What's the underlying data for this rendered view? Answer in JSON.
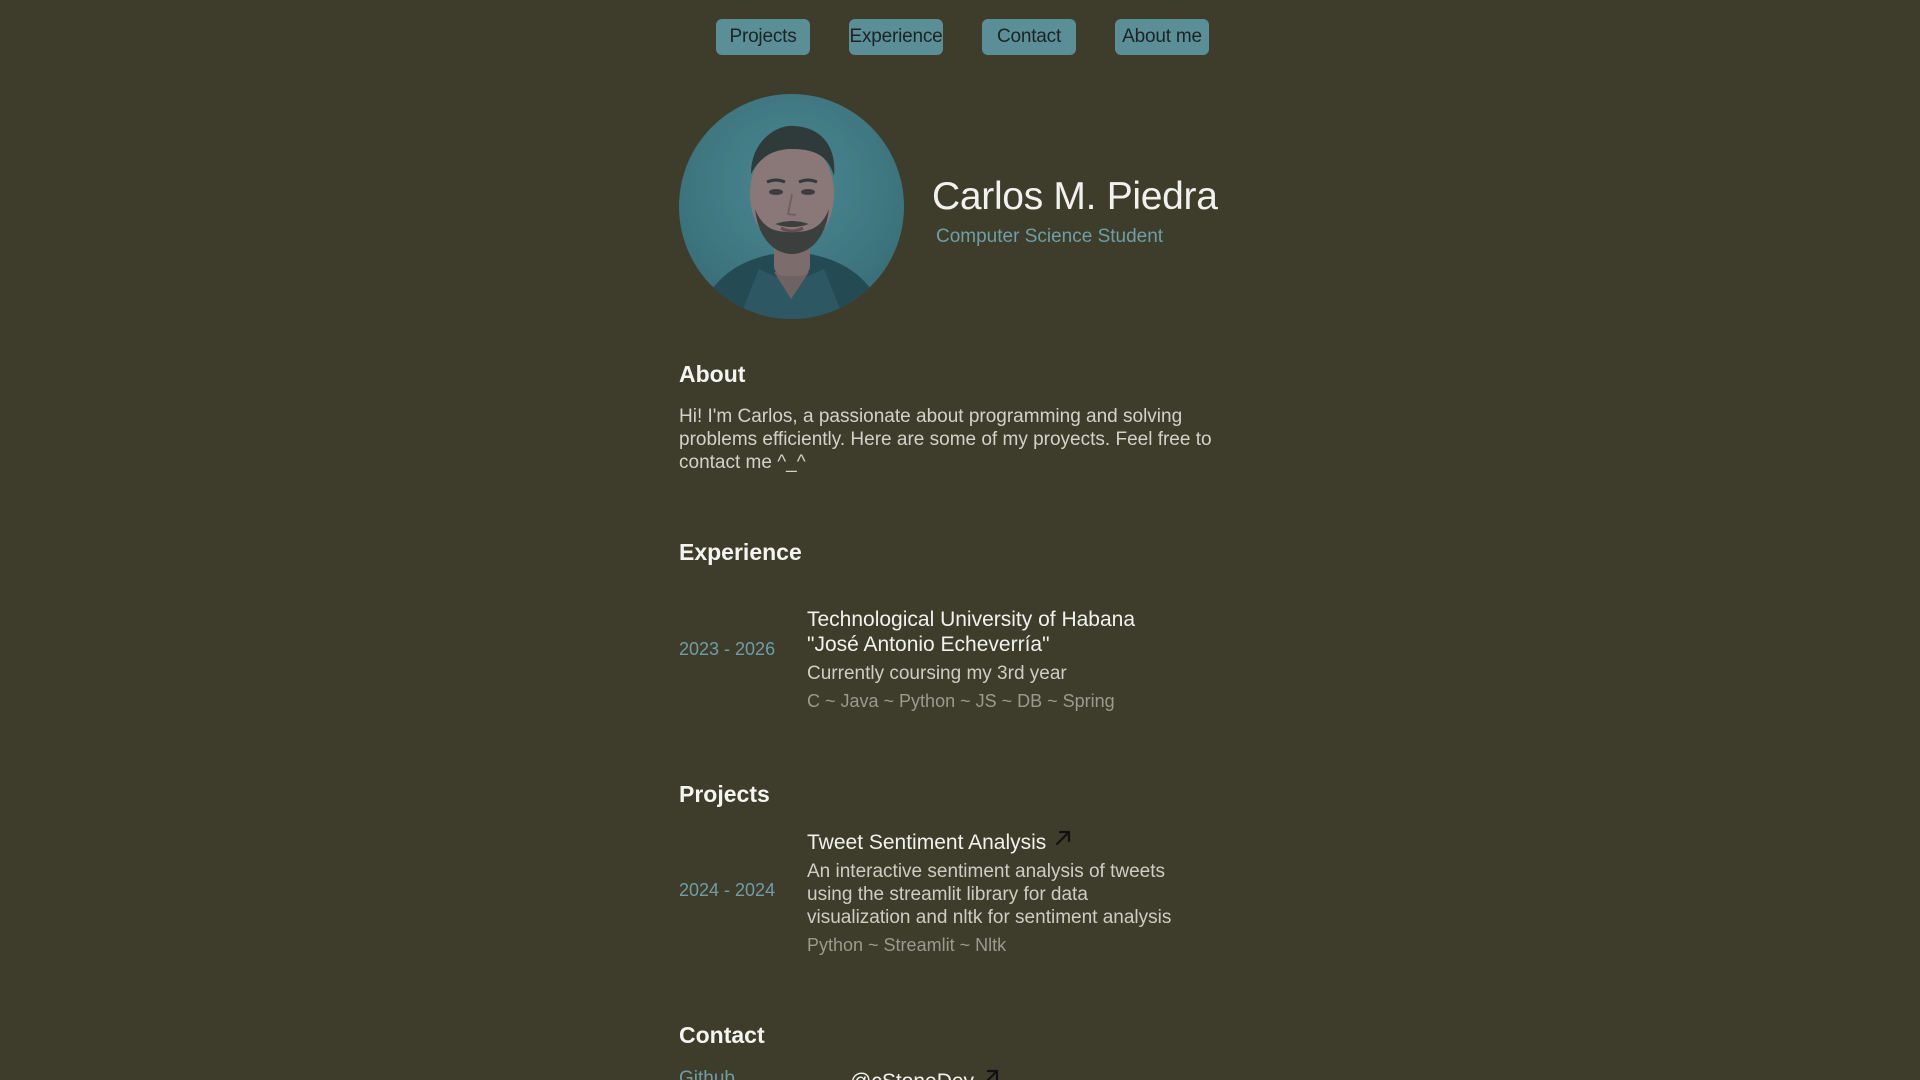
{
  "nav": {
    "items": [
      {
        "label": "Projects"
      },
      {
        "label": "Experience"
      },
      {
        "label": "Contact"
      },
      {
        "label": "About me"
      }
    ]
  },
  "profile": {
    "name": "Carlos M. Piedra",
    "role": "Computer Science Student",
    "avatar_icon": "profile-photo"
  },
  "about": {
    "heading": "About",
    "text": "Hi! I'm Carlos, a passionate about programming and solving problems efficiently. Here are some of my proyects. Feel free to contact me ^_^"
  },
  "experience": {
    "heading": "Experience",
    "items": [
      {
        "period": "2023 - 2026",
        "title_line1": "Technological University of Habana",
        "title_line2": "\"José Antonio Echeverría\"",
        "description": "Currently coursing my 3rd year",
        "tags": "C ~ Java ~ Python ~ JS ~ DB ~ Spring"
      }
    ]
  },
  "projects": {
    "heading": "Projects",
    "items": [
      {
        "period": "2024 - 2024",
        "title": "Tweet Sentiment Analysis",
        "link_icon": "external-link-arrow-icon",
        "description": "An interactive sentiment analysis of tweets using the streamlit library for data visualization and nltk for sentiment analysis",
        "tags": "Python ~ Streamlit ~ Nltk"
      }
    ]
  },
  "contact": {
    "heading": "Contact",
    "items": [
      {
        "label": "Github",
        "value": "@cStoneDev",
        "link_icon": "external-link-arrow-icon"
      }
    ]
  },
  "colors": {
    "background": "#3e3d2b",
    "accent": "#5b8f98",
    "accent_text": "#6f9ea6",
    "text_primary": "#f1f1ee"
  }
}
